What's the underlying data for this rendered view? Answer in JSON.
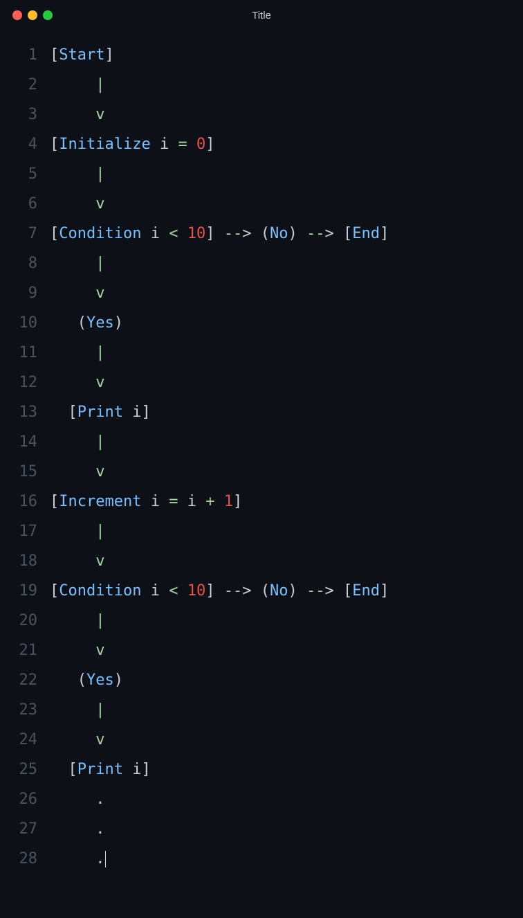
{
  "window": {
    "title": "Title"
  },
  "editor": {
    "lines": [
      {
        "num": "1",
        "tokens": [
          {
            "t": "[",
            "c": "bracket"
          },
          {
            "t": "Start",
            "c": "kw"
          },
          {
            "t": "]",
            "c": "bracket"
          }
        ]
      },
      {
        "num": "2",
        "tokens": [
          {
            "t": "     ",
            "c": "plain"
          },
          {
            "t": "|",
            "c": "pipe"
          }
        ]
      },
      {
        "num": "3",
        "tokens": [
          {
            "t": "     ",
            "c": "plain"
          },
          {
            "t": "v",
            "c": "pipe"
          }
        ]
      },
      {
        "num": "4",
        "tokens": [
          {
            "t": "[",
            "c": "bracket"
          },
          {
            "t": "Initialize",
            "c": "kw"
          },
          {
            "t": " i ",
            "c": "plain"
          },
          {
            "t": "=",
            "c": "eq"
          },
          {
            "t": " ",
            "c": "plain"
          },
          {
            "t": "0",
            "c": "num"
          },
          {
            "t": "]",
            "c": "bracket"
          }
        ]
      },
      {
        "num": "5",
        "tokens": [
          {
            "t": "     ",
            "c": "plain"
          },
          {
            "t": "|",
            "c": "pipe"
          }
        ]
      },
      {
        "num": "6",
        "tokens": [
          {
            "t": "     ",
            "c": "plain"
          },
          {
            "t": "v",
            "c": "pipe"
          }
        ]
      },
      {
        "num": "7",
        "tokens": [
          {
            "t": "[",
            "c": "bracket"
          },
          {
            "t": "Condition",
            "c": "kw"
          },
          {
            "t": " i ",
            "c": "plain"
          },
          {
            "t": "<",
            "c": "lt"
          },
          {
            "t": " ",
            "c": "plain"
          },
          {
            "t": "10",
            "c": "num"
          },
          {
            "t": "] ",
            "c": "bracket"
          },
          {
            "t": "--",
            "c": "arrow"
          },
          {
            "t": ">",
            "c": "bracket"
          },
          {
            "t": " (",
            "c": "paren"
          },
          {
            "t": "No",
            "c": "kw"
          },
          {
            "t": ") ",
            "c": "paren"
          },
          {
            "t": "--",
            "c": "arrow"
          },
          {
            "t": ">",
            "c": "bracket"
          },
          {
            "t": " [",
            "c": "bracket"
          },
          {
            "t": "End",
            "c": "kw"
          },
          {
            "t": "]",
            "c": "bracket"
          }
        ]
      },
      {
        "num": "8",
        "tokens": [
          {
            "t": "     ",
            "c": "plain"
          },
          {
            "t": "|",
            "c": "pipe"
          }
        ]
      },
      {
        "num": "9",
        "tokens": [
          {
            "t": "     ",
            "c": "plain"
          },
          {
            "t": "v",
            "c": "pipe"
          }
        ]
      },
      {
        "num": "10",
        "tokens": [
          {
            "t": "   (",
            "c": "paren"
          },
          {
            "t": "Yes",
            "c": "kw"
          },
          {
            "t": ")",
            "c": "paren"
          }
        ]
      },
      {
        "num": "11",
        "tokens": [
          {
            "t": "     ",
            "c": "plain"
          },
          {
            "t": "|",
            "c": "pipe"
          }
        ]
      },
      {
        "num": "12",
        "tokens": [
          {
            "t": "     ",
            "c": "plain"
          },
          {
            "t": "v",
            "c": "pipe"
          }
        ]
      },
      {
        "num": "13",
        "tokens": [
          {
            "t": "  [",
            "c": "bracket"
          },
          {
            "t": "Print",
            "c": "kw"
          },
          {
            "t": " i]",
            "c": "bracket"
          }
        ]
      },
      {
        "num": "14",
        "tokens": [
          {
            "t": "     ",
            "c": "plain"
          },
          {
            "t": "|",
            "c": "pipe"
          }
        ]
      },
      {
        "num": "15",
        "tokens": [
          {
            "t": "     ",
            "c": "plain"
          },
          {
            "t": "v",
            "c": "pipe"
          }
        ]
      },
      {
        "num": "16",
        "tokens": [
          {
            "t": "[",
            "c": "bracket"
          },
          {
            "t": "Increment",
            "c": "kw"
          },
          {
            "t": " i ",
            "c": "plain"
          },
          {
            "t": "=",
            "c": "eq"
          },
          {
            "t": " i ",
            "c": "plain"
          },
          {
            "t": "+",
            "c": "eq"
          },
          {
            "t": " ",
            "c": "plain"
          },
          {
            "t": "1",
            "c": "num"
          },
          {
            "t": "]",
            "c": "bracket"
          }
        ]
      },
      {
        "num": "17",
        "tokens": [
          {
            "t": "     ",
            "c": "plain"
          },
          {
            "t": "|",
            "c": "pipe"
          }
        ]
      },
      {
        "num": "18",
        "tokens": [
          {
            "t": "     ",
            "c": "plain"
          },
          {
            "t": "v",
            "c": "pipe"
          }
        ]
      },
      {
        "num": "19",
        "tokens": [
          {
            "t": "[",
            "c": "bracket"
          },
          {
            "t": "Condition",
            "c": "kw"
          },
          {
            "t": " i ",
            "c": "plain"
          },
          {
            "t": "<",
            "c": "lt"
          },
          {
            "t": " ",
            "c": "plain"
          },
          {
            "t": "10",
            "c": "num"
          },
          {
            "t": "] ",
            "c": "bracket"
          },
          {
            "t": "--",
            "c": "arrow"
          },
          {
            "t": ">",
            "c": "bracket"
          },
          {
            "t": " (",
            "c": "paren"
          },
          {
            "t": "No",
            "c": "kw"
          },
          {
            "t": ") ",
            "c": "paren"
          },
          {
            "t": "--",
            "c": "arrow"
          },
          {
            "t": ">",
            "c": "bracket"
          },
          {
            "t": " [",
            "c": "bracket"
          },
          {
            "t": "End",
            "c": "kw"
          },
          {
            "t": "]",
            "c": "bracket"
          }
        ]
      },
      {
        "num": "20",
        "tokens": [
          {
            "t": "     ",
            "c": "plain"
          },
          {
            "t": "|",
            "c": "pipe"
          }
        ]
      },
      {
        "num": "21",
        "tokens": [
          {
            "t": "     ",
            "c": "plain"
          },
          {
            "t": "v",
            "c": "pipe"
          }
        ]
      },
      {
        "num": "22",
        "tokens": [
          {
            "t": "   (",
            "c": "paren"
          },
          {
            "t": "Yes",
            "c": "kw"
          },
          {
            "t": ")",
            "c": "paren"
          }
        ]
      },
      {
        "num": "23",
        "tokens": [
          {
            "t": "     ",
            "c": "plain"
          },
          {
            "t": "|",
            "c": "pipe"
          }
        ]
      },
      {
        "num": "24",
        "tokens": [
          {
            "t": "     ",
            "c": "plain"
          },
          {
            "t": "v",
            "c": "pipe"
          }
        ]
      },
      {
        "num": "25",
        "tokens": [
          {
            "t": "  [",
            "c": "bracket"
          },
          {
            "t": "Print",
            "c": "kw"
          },
          {
            "t": " i]",
            "c": "bracket"
          }
        ]
      },
      {
        "num": "26",
        "tokens": [
          {
            "t": "     .",
            "c": "dot"
          }
        ]
      },
      {
        "num": "27",
        "tokens": [
          {
            "t": "     .",
            "c": "dot"
          }
        ]
      },
      {
        "num": "28",
        "tokens": [
          {
            "t": "     .",
            "c": "dot"
          }
        ],
        "cursor": true
      }
    ]
  }
}
